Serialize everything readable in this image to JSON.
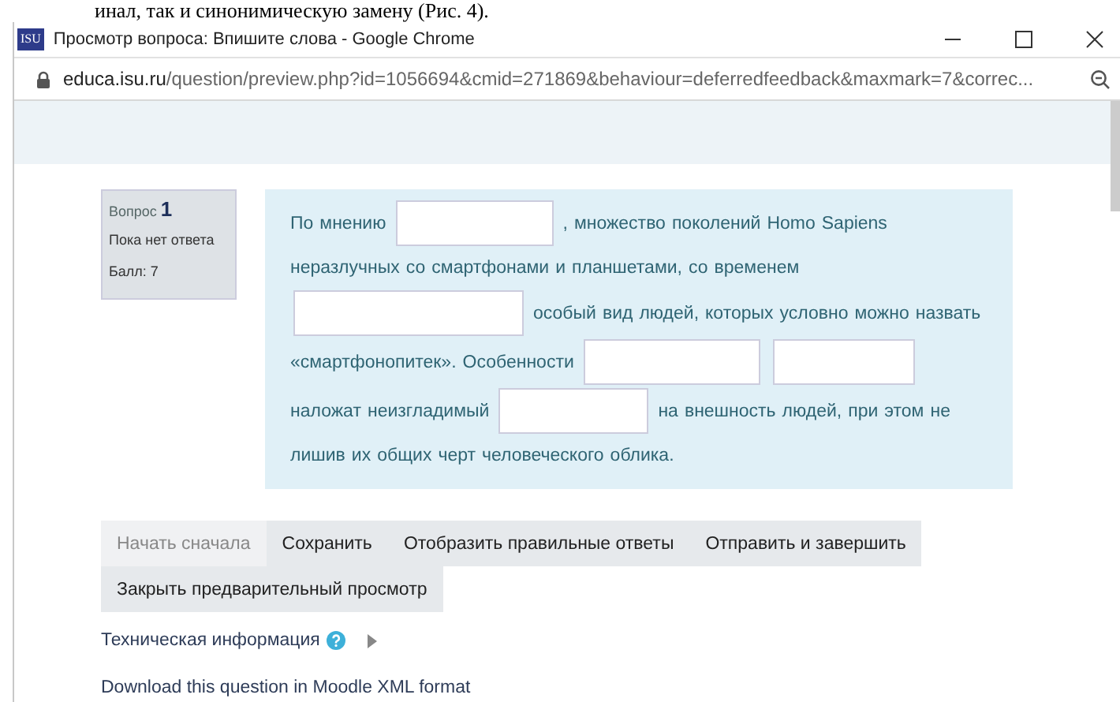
{
  "document_line": "инал, так и синонимическую замену (Рис. 4).",
  "window": {
    "icon_text": "ISU",
    "title": "Просмотр вопроса: Впишите слова - Google Chrome"
  },
  "address_bar": {
    "domain": "educa.isu.ru",
    "path": "/question/preview.php?id=1056694&cmid=271869&behaviour=deferredfeedback&maxmark=7&correc..."
  },
  "question_info": {
    "label": "Вопрос",
    "number": "1",
    "state": "Пока нет ответа",
    "grade": "Балл: 7"
  },
  "question_text": [
    {
      "kind": "text",
      "text": "По мнению"
    },
    {
      "kind": "blank"
    },
    {
      "kind": "text",
      "text": ", множество поколений Homo Sapiens неразлучных со смартфонами и планшетами, со временем"
    },
    {
      "kind": "blank"
    },
    {
      "kind": "text",
      "text": "особый вид людей, которых условно можно назвать «смартфонопитек». Особенности"
    },
    {
      "kind": "blank"
    },
    {
      "kind": "blank"
    },
    {
      "kind": "text",
      "text": "наложат неизгладимый"
    },
    {
      "kind": "blank"
    },
    {
      "kind": "text",
      "text": "на внешность людей, при этом не лишив их общих черт человеческого облика."
    }
  ],
  "buttons": [
    {
      "label": "Начать сначала",
      "disabled": true
    },
    {
      "label": "Сохранить",
      "disabled": false
    },
    {
      "label": "Отобразить правильные ответы",
      "disabled": false
    },
    {
      "label": "Отправить и завершить",
      "disabled": false
    },
    {
      "label": "Закрыть предварительный просмотр",
      "disabled": false
    }
  ],
  "tech_info": "Техническая информация",
  "download_link": "Download this question in Moodle XML format"
}
